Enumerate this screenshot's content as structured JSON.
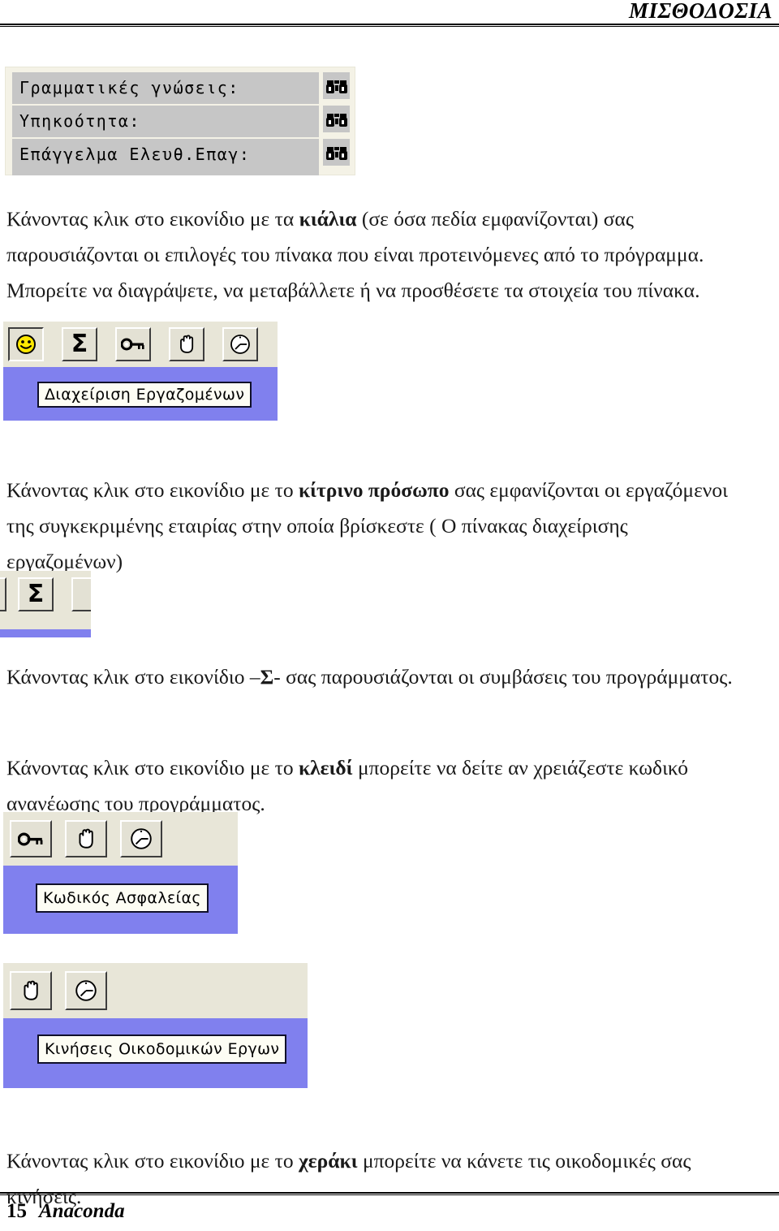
{
  "header": {
    "title": "ΜΙΣΘΟΔΟΣΙΑ"
  },
  "footer": {
    "page_number": "15",
    "brand": "Anaconda"
  },
  "form_screenshot": {
    "name": "employee-detail-fields",
    "fields": [
      {
        "label": "Γραμματικές γνώσεις:",
        "icon": "binoculars-icon"
      },
      {
        "label": "Υπηκοότητα:",
        "icon": "binoculars-icon"
      },
      {
        "label": "Επάγγελμα Ελευθ.Επαγ:",
        "icon": "binoculars-icon"
      }
    ]
  },
  "paragraphs": {
    "binoculars": {
      "prefix": "Κάνοντας κλικ στο εικονίδιο με τα ",
      "bold": "κιάλια",
      "suffix": " (σε όσα πεδία εμφανίζονται) σας παρουσιάζονται οι επιλογές του πίνακα που είναι προτεινόμενες από το πρόγραμμα. Μπορείτε να διαγράψετε, να μεταβάλλετε ή να προσθέσετε τα στοιχεία του πίνακα."
    },
    "yellow_face": {
      "prefix": "Κάνοντας κλικ στο εικονίδιο με το ",
      "bold": "κίτρινο πρόσωπο",
      "suffix": " σας εμφανίζονται οι εργαζόμενοι της συγκεκριμένης εταιρίας στην οποία βρίσκεστε ( Ο πίνακας  διαχείρισης εργαζομένων)"
    },
    "sigma": {
      "prefix": "Κάνοντας κλικ στο εικονίδιο –",
      "bold": "Σ",
      "suffix": "- σας παρουσιάζονται οι συμβάσεις του προγράμματος."
    },
    "key": {
      "prefix": "Κάνοντας κλικ στο εικονίδιο με το ",
      "bold": "κλειδί",
      "suffix": " μπορείτε να δείτε αν χρειάζεστε κωδικό ανανέωσης του προγράμματος."
    },
    "hand": {
      "prefix": "Κάνοντας κλικ στο εικονίδιο με το ",
      "bold": "χεράκι",
      "suffix": " μπορείτε να κάνετε τις οικοδομικές σας κινήσεις."
    }
  },
  "toolbars": {
    "employees": {
      "buttons": [
        {
          "icon": "smiley-face-icon",
          "state": "pressed"
        },
        {
          "icon": "sigma-icon",
          "state": "normal"
        },
        {
          "icon": "key-icon",
          "state": "normal"
        },
        {
          "icon": "hand-icon",
          "state": "normal"
        },
        {
          "icon": "clock-icon",
          "state": "normal"
        }
      ],
      "tooltip": "Διαχείριση Εργαζομένων"
    },
    "sigma_fragment": {
      "buttons": [
        {
          "icon": "sigma-icon",
          "state": "normal"
        }
      ]
    },
    "security": {
      "buttons": [
        {
          "icon": "key-icon",
          "state": "normal"
        },
        {
          "icon": "hand-icon",
          "state": "normal"
        },
        {
          "icon": "clock-icon",
          "state": "normal"
        }
      ],
      "tooltip": "Κωδικός Ασφαλείας"
    },
    "works": {
      "buttons": [
        {
          "icon": "hand-icon",
          "state": "normal"
        },
        {
          "icon": "clock-icon",
          "state": "normal"
        }
      ],
      "tooltip": "Κινήσεις Οικοδομικών Εργων"
    }
  },
  "colors": {
    "tooltip_panel": "#8080ee",
    "toolbar_face": "#e3e1d4",
    "field_gray": "#c6c6c6",
    "smiley_yellow": "#ffe800"
  }
}
